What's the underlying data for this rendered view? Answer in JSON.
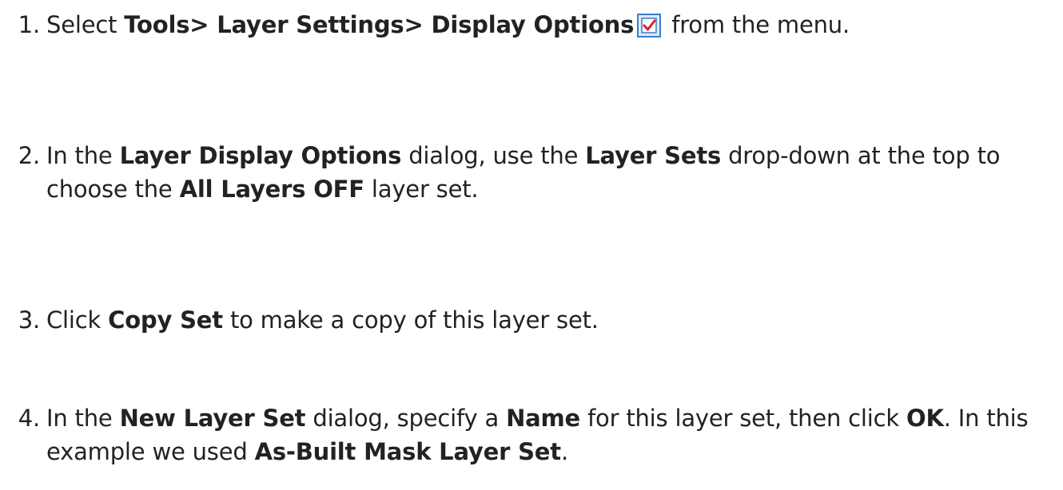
{
  "steps": [
    {
      "number": "1.",
      "parts": [
        {
          "t": "Select ",
          "b": false
        },
        {
          "t": "Tools> Layer Settings> Display Options",
          "b": true
        },
        {
          "icon": "display-options-icon"
        },
        {
          "t": " from the menu.",
          "b": false
        }
      ]
    },
    {
      "number": "2.",
      "parts": [
        {
          "t": "In the ",
          "b": false
        },
        {
          "t": "Layer Display Options",
          "b": true
        },
        {
          "t": " dialog, use the ",
          "b": false
        },
        {
          "t": "Layer Sets",
          "b": true
        },
        {
          "t": " drop-down at the top to",
          "b": false
        },
        {
          "br": true
        },
        {
          "t": "choose the ",
          "b": false
        },
        {
          "t": "All Layers OFF",
          "b": true
        },
        {
          "t": " layer set.",
          "b": false
        }
      ]
    },
    {
      "number": "3.",
      "parts": [
        {
          "t": "Click ",
          "b": false
        },
        {
          "t": "Copy Set",
          "b": true
        },
        {
          "t": " to make a copy of this layer set.",
          "b": false
        }
      ]
    },
    {
      "number": "4.",
      "parts": [
        {
          "t": "In the ",
          "b": false
        },
        {
          "t": "New Layer Set",
          "b": true
        },
        {
          "t": " dialog, specify a ",
          "b": false
        },
        {
          "t": "Name",
          "b": true
        },
        {
          "t": " for this layer set, then click ",
          "b": false
        },
        {
          "t": "OK",
          "b": true
        },
        {
          "t": ". In this",
          "b": false
        },
        {
          "br": true
        },
        {
          "t": "example we used ",
          "b": false
        },
        {
          "t": "As-Built Mask Layer Set",
          "b": true
        },
        {
          "t": ".",
          "b": false
        }
      ]
    }
  ],
  "colors": {
    "text": "#222222",
    "icon_border": "#3a7fc4",
    "icon_fill": "#dcecf9",
    "check": "#d8242b"
  }
}
